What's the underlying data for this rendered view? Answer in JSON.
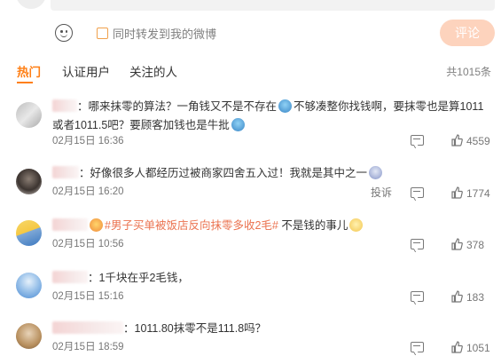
{
  "composer": {
    "repost_label": "同时转发到我的微博",
    "submit_label": "评论"
  },
  "tabs": [
    {
      "label": "热门",
      "active": true
    },
    {
      "label": "认证用户",
      "active": false
    },
    {
      "label": "关注的人",
      "active": false
    }
  ],
  "total_count": "共1015条",
  "comments": [
    {
      "text_a": "：哪来抹零的算法？一角钱又不是不存在",
      "text_b": "不够凑整你找钱啊，要抹零也是算1011或者1011.5吧？要顾客加钱也是牛批",
      "date": "02月15日 16:36",
      "likes": "4559",
      "avatar_color": "#c9c9c9"
    },
    {
      "text_a": "：好像很多人都经历过被商家四舍五入过！我就是其中之一",
      "date": "02月15日 16:20",
      "complain": "投诉",
      "likes": "1774",
      "avatar_color": "#5a4f48"
    },
    {
      "tag": "#男子买单被饭店反向抹零多收2毛#",
      "text_a": "不是钱的事儿",
      "date": "02月15日 10:56",
      "likes": "378",
      "avatar_color": "#f5cf57"
    },
    {
      "text_a": "：1千块在乎2毛钱，",
      "date": "02月15日 15:16",
      "likes": "183",
      "avatar_color": "#8fb7e0"
    },
    {
      "text_a": "：1011.80抹零不是111.8吗？",
      "date": "02月15日 18:59",
      "likes": "1051",
      "avatar_color": "#c8a680"
    }
  ]
}
